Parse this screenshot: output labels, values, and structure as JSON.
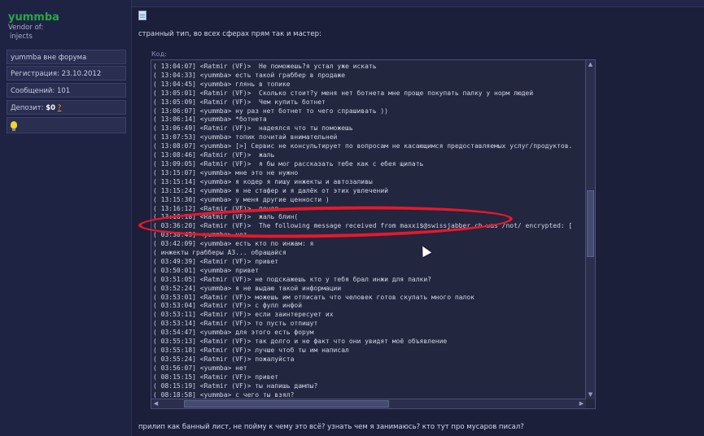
{
  "sidebar": {
    "username": "yummba",
    "user_title_line1": "Vendor of:",
    "user_title_line2": "injects",
    "status": "yummba вне форума",
    "registration": "Регистрация: 23.10.2012",
    "messages": "Сообщений: 101",
    "deposit_label": "Депозит:",
    "deposit_value": "$0",
    "deposit_link": "?"
  },
  "post": {
    "intro_text": "странный тип, во всех сферах прям так и мастер:",
    "code_label": "Код:",
    "outro_text": "прилип как банный лист, не пойму к чему это всё? узнать чем я занимаюсь? кто тут про мусаров писал?"
  },
  "code_lines": [
    "( 13:04:07] <Ratmir (VF)>  Не поможешь?я устал уже искать",
    "( 13:04:33] <yummba> есть такой граббер в продаже",
    "( 13:04:45] <yummba> глянь в топике",
    "( 13:05:01] <Ratmir (VF)>  Сколько стоит?у меня нет ботнета мне проще покупать палку у норм людей",
    "( 13:05:09] <Ratmir (VF)>  Чем купить ботнет",
    "( 13:06:07] <yummba> ну раз нет ботнет то чего спрашивать ))",
    "( 13:06:14] <yummba> *ботнета",
    "( 13:06:49] <Ratmir (VF)>  надеялся что ты поможешь",
    "( 13:07:53] <yummba> топик почитай внимательней",
    "( 13:08:07] <yummba> [>] Сервис не консультирует по вопросам не касающимся предоставляемых услуг/продуктов.",
    "( 13:08:46] <Ratmir (VF)>  жаль",
    "( 13:09:05] <Ratmir (VF)>  я бы мог рассказать тебе как с ебея щипать",
    "( 13:15:07] <yummba> мне это не нужно",
    "( 13:15:14] <yummba> я кодер я пишу инжекты и автозаливы",
    "( 13:15:24] <yummba> я не стафер и я далёк от этих увлечений",
    "( 13:15:30] <yummba> у меня другие ценности )",
    "( 13:16:12] <Ratmir (VF)>  понял",
    "( 13:16:18] <Ratmir (VF)>  жаль блин(",
    "( 03:36:20] <Ratmir (VF)>  The following message received from maxxi$@swissjabber.ch was /not/ encrypted: [",
    "( 03:38:49] <yummba> нет",
    "( 03:42:09] <yummba> есть кто по инжам: я",
    "( инжекты грабберы АЗ... обращайся",
    "( 03:49:39] <Ratmir (VF)> привет",
    "( 03:50:01] <yummba> привет",
    "( 03:51:05] <Ratmir (VF)> не подскажешь кто у тебя брал инжи для палки?",
    "( 03:52:24] <yummba> я не выдаю такой информации",
    "( 03:53:01] <Ratmir (VF)> можешь им отписать что человек готов скупать много палок",
    "( 03:53:04] <Ratmir (VF)> с фулл инфой",
    "( 03:53:11] <Ratmir (VF)> если заинтересует их",
    "( 03:53:14] <Ratmir (VF)> то пусть отпишут",
    "( 03:54:47] <yummba> для этого есть форум",
    "( 03:55:13] <Ratmir (VF)> так долго и не факт что они увидят моё объявление",
    "( 03:55:18] <Ratmir (VF)> лучше чтоб ты им написал",
    "( 03:55:24] <Ratmir (VF)> пожалуйста",
    "( 03:56:07] <yummba> нет",
    "( 08:15:15] <Ratmir (VF)> привет",
    "( 08:15:19] <Ratmir (VF)> ты напишь дампы?",
    "( 08:18:58] <yummba> с чего ты взял?"
  ],
  "colors": {
    "background": "#1b1f3a",
    "username": "#27a844",
    "highlight_circle": "#e8182a"
  }
}
